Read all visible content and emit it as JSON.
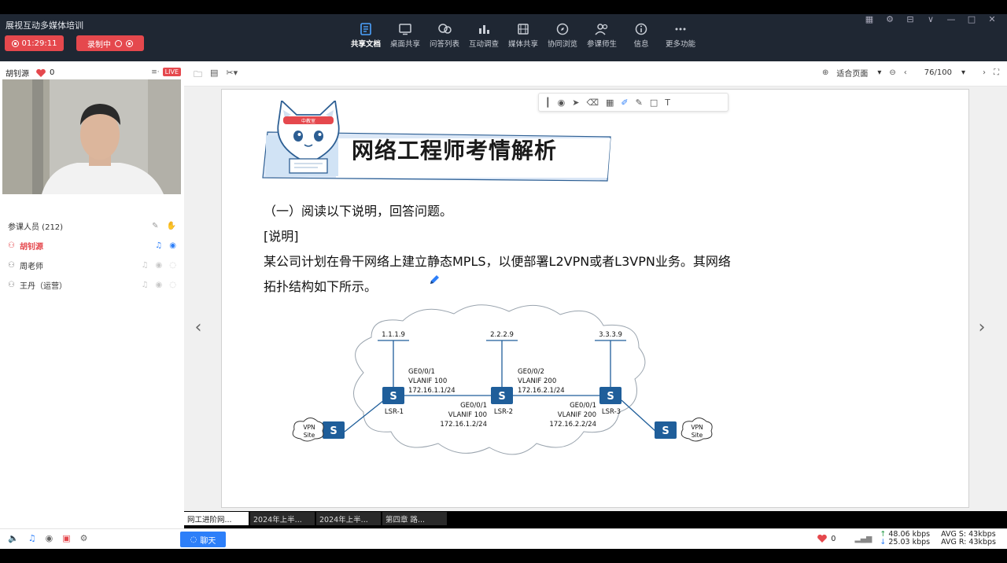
{
  "app": {
    "title": "展视互动多媒体培训"
  },
  "session": {
    "timer": "01:29:11",
    "record_label": "录制中"
  },
  "toolbar": {
    "items": [
      {
        "label": "共享文档",
        "icon": "document-icon"
      },
      {
        "label": "桌面共享",
        "icon": "monitor-icon"
      },
      {
        "label": "问答列表",
        "icon": "qa-icon"
      },
      {
        "label": "互动调查",
        "icon": "chart-icon"
      },
      {
        "label": "媒体共享",
        "icon": "film-icon"
      },
      {
        "label": "协同浏览",
        "icon": "compass-icon"
      },
      {
        "label": "参课师生",
        "icon": "users-icon"
      },
      {
        "label": "信息",
        "icon": "info-icon"
      },
      {
        "label": "更多功能",
        "icon": "more-icon"
      }
    ]
  },
  "presenter": {
    "name": "胡钊源",
    "likes": "0",
    "live_badge": "LIVE"
  },
  "participants": {
    "header": "参课人员 (212)",
    "list": [
      {
        "name": "胡钊源"
      },
      {
        "name": "周老师"
      },
      {
        "name": "王丹（运营）"
      }
    ]
  },
  "docbar": {
    "zoom_label": "适合页面",
    "page": "76/100"
  },
  "slide": {
    "banner_title": "网络工程师考情解析",
    "mascot_badge": "中教室",
    "line1": "（一）阅读以下说明，回答问题。",
    "line2": "[说明]",
    "line3": "某公司计划在骨干网络上建立静态MPLS，以便部署L2VPN或者L3VPN业务。其网络",
    "line4": "拓扑结构如下所示。",
    "diagram": {
      "loopbacks": [
        "1.1.1.9",
        "2.2.2.9",
        "3.3.3.9"
      ],
      "lsr_labels": [
        "LSR-1",
        "LSR-2",
        "LSR-3"
      ],
      "if1": [
        "GE0/0/1",
        "VLANIF 100",
        "172.16.1.1/24"
      ],
      "if2": [
        "GE0/0/2",
        "VLANIF 200",
        "172.16.2.1/24"
      ],
      "if3": [
        "GE0/0/1",
        "VLANIF 100",
        "172.16.1.2/24"
      ],
      "if4": [
        "GE0/0/1",
        "VLANIF 200",
        "172.16.2.2/24"
      ],
      "vpn_site": [
        "VPN",
        "Site"
      ],
      "switch_glyph": "S"
    }
  },
  "tabs": [
    {
      "label": "网工进阶网..."
    },
    {
      "label": "2024年上半..."
    },
    {
      "label": "2024年上半..."
    },
    {
      "label": "第四章  路..."
    }
  ],
  "footer": {
    "chat_label": "聊天",
    "likes": "0",
    "up_rate": "48.06 kbps",
    "down_rate": "25.03 kbps",
    "avg_s": "AVG S: 43kbps",
    "avg_r": "AVG R: 43kbps"
  },
  "colors": {
    "accent": "#2d7ff9",
    "record": "#e5484d",
    "topbar": "#1f2733",
    "switch": "#1f5e9a"
  }
}
